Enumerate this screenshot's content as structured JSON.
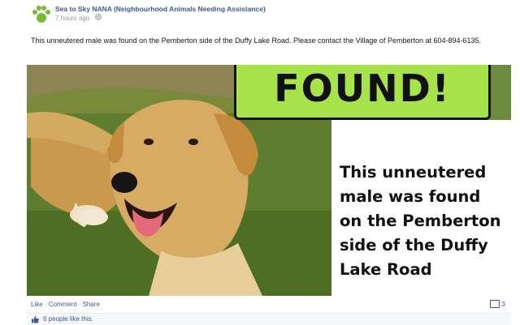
{
  "post": {
    "page_name": "Sea to Sky NANA (Neighbourhood Animals Needing Assistance)",
    "timestamp": "7 hours ago",
    "globe_icon": "globe-icon",
    "caption": "This unneutered male was found on the Pemberton side of the Duffy Lake Road. Please contact the Village of Pemberton at 604-894-6135."
  },
  "photo": {
    "banner_text": "FOUND!",
    "poster_text": "This unneutered male was found on the Pemberton side of the Duffy Lake Road",
    "banner_color": "#a9e34b"
  },
  "actions": {
    "like": "Like",
    "comment": "Comment",
    "share": "Share",
    "separator": " · ",
    "comment_count": "3"
  },
  "likes": {
    "text": "6 people like this."
  },
  "icons": {
    "avatar": "paw-print-icon",
    "comment_count": "comment-bubble-icon",
    "like": "thumbs-up-icon"
  }
}
